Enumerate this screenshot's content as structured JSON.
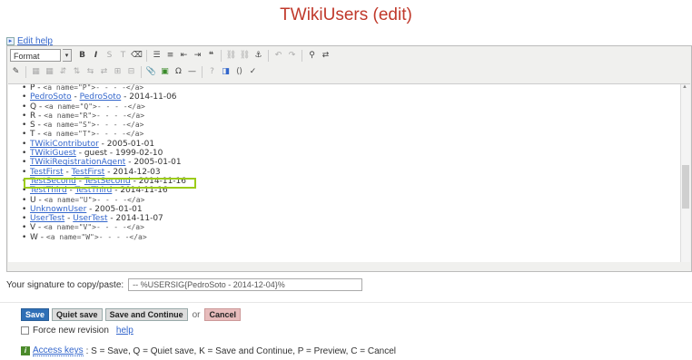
{
  "page": {
    "title": "TWikiUsers (edit)"
  },
  "edit_help": {
    "label": "Edit help"
  },
  "toolbar": {
    "format_value": "Format",
    "icons": [
      "bold-icon",
      "italic-icon"
    ]
  },
  "entries": [
    {
      "kind": "anchor",
      "letter": "P",
      "code": "<a name=\"P\">- - - -</a>"
    },
    {
      "kind": "user",
      "name": "PedroSoto",
      "link": "PedroSoto",
      "date": "2014-11-06"
    },
    {
      "kind": "anchor",
      "letter": "Q",
      "code": "<a name=\"Q\">- - - -</a>"
    },
    {
      "kind": "anchor",
      "letter": "R",
      "code": "<a name=\"R\">- - - -</a>"
    },
    {
      "kind": "anchor",
      "letter": "S",
      "code": "<a name=\"S\">- - - -</a>"
    },
    {
      "kind": "anchor",
      "letter": "T",
      "code": "<a name=\"T\">- - - -</a>"
    },
    {
      "kind": "user1",
      "name": "TWikiContributor",
      "date": "2005-01-01"
    },
    {
      "kind": "guest",
      "name": "TWikiGuest",
      "extra": "guest",
      "date": "1999-02-10"
    },
    {
      "kind": "user1",
      "name": "TWikiRegistrationAgent",
      "date": "2005-01-01"
    },
    {
      "kind": "user",
      "name": "TestFirst",
      "link": "TestFirst",
      "date": "2014-12-03"
    },
    {
      "kind": "user",
      "name": "TestSecond",
      "link": "TestSecond",
      "date": "2014-11-16"
    },
    {
      "kind": "user",
      "name": "TestThird",
      "link": "TestThird",
      "date": "2014-11-16"
    },
    {
      "kind": "anchor",
      "letter": "U",
      "code": "<a name=\"U\">- - - -</a>"
    },
    {
      "kind": "user1",
      "name": "UnknownUser",
      "date": "2005-01-01"
    },
    {
      "kind": "user",
      "name": "UserTest",
      "link": "UserTest",
      "date": "2014-11-07"
    },
    {
      "kind": "anchor",
      "letter": "V",
      "code": "<a name=\"V\">- - - -</a>"
    },
    {
      "kind": "anchor",
      "letter": "W",
      "code": "<a name=\"W\">- - - -</a>"
    }
  ],
  "signature": {
    "label": "Your signature to copy/paste:",
    "value": "-- %USERSIG{PedroSoto - 2014-12-04}%"
  },
  "actions": {
    "save": "Save",
    "quiet_save": "Quiet save",
    "save_continue": "Save and Continue",
    "or": "or",
    "cancel": "Cancel"
  },
  "force": {
    "label": "Force new revision",
    "help": "help"
  },
  "access": {
    "link": "Access keys",
    "text": ": S = Save, Q = Quiet save, K = Save and Continue, P = Preview, C = Cancel"
  },
  "colors": {
    "title": "#c0392b",
    "link": "#3366cc",
    "highlight": "#9ccc19",
    "save_button": "#2f6fb6",
    "cancel_button": "#e7bcbc"
  }
}
